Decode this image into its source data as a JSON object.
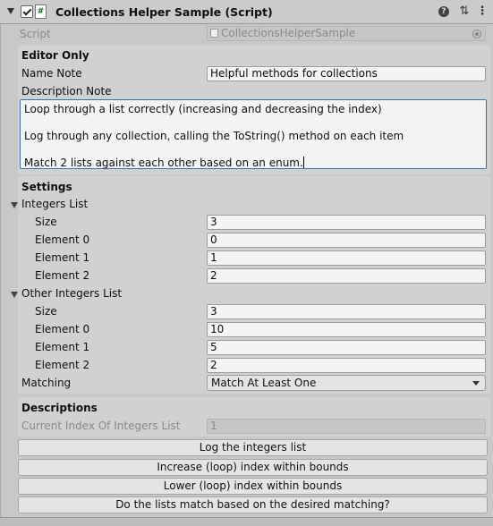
{
  "header": {
    "title": "Collections Helper Sample (Script)",
    "script_icon": "#",
    "icons": [
      "fold-arrow-icon",
      "checkbox-icon",
      "script-icon",
      "help-icon",
      "preset-icon",
      "menu-icon"
    ]
  },
  "script_row": {
    "label": "Script",
    "value": "CollectionsHelperSample"
  },
  "editor_only": {
    "heading": "Editor Only",
    "name_note_label": "Name Note",
    "name_note_value": "Helpful methods for collections",
    "description_label": "Description Note",
    "description_lines": [
      "Loop through a list correctly (increasing and decreasing the index)",
      "Log through any collection, calling the ToString() method on each item",
      "Match 2 lists against each other based on an enum."
    ]
  },
  "settings": {
    "heading": "Settings",
    "integers_list": {
      "label": "Integers List",
      "size_label": "Size",
      "size": "3",
      "elements": [
        {
          "label": "Element 0",
          "value": "0"
        },
        {
          "label": "Element 1",
          "value": "1"
        },
        {
          "label": "Element 2",
          "value": "2"
        }
      ]
    },
    "other_integers_list": {
      "label": "Other Integers List",
      "size_label": "Size",
      "size": "3",
      "elements": [
        {
          "label": "Element 0",
          "value": "10"
        },
        {
          "label": "Element 1",
          "value": "5"
        },
        {
          "label": "Element 2",
          "value": "2"
        }
      ]
    },
    "matching_label": "Matching",
    "matching_value": "Match At Least One"
  },
  "descriptions": {
    "heading": "Descriptions",
    "current_index_label": "Current Index Of Integers List",
    "current_index_value": "1"
  },
  "buttons": {
    "log": "Log the integers list",
    "increase": "Increase (loop) index within bounds",
    "lower": "Lower (loop) index within bounds",
    "match": "Do the lists match based on the desired matching?"
  }
}
